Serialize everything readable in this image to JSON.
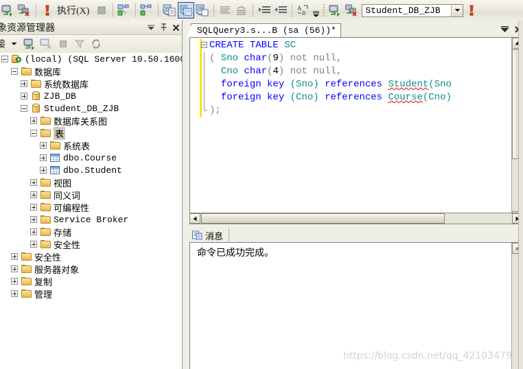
{
  "toolbar": {
    "buttons": [
      {
        "name": "connect-object-explorer-icon",
        "tip": "连接"
      },
      {
        "name": "disconnect-object-explorer-icon",
        "tip": "断开连接"
      },
      {
        "name": "execute-exclamation-icon",
        "tip": "执行"
      }
    ],
    "execute_label": "执行(X)",
    "database_value": "Student_DB_ZJB",
    "overflow_label": "▼"
  },
  "object_explorer": {
    "title": "象资源管理器",
    "title_full": "对象资源管理器",
    "auto_hide_label": "⚏",
    "close_label": "✕",
    "toolbar": {
      "connect_label": "接",
      "connect_label_full": "连接",
      "dropdown_arrow": "▾"
    },
    "tree": [
      {
        "level": 0,
        "expander": "minus",
        "icon": "server-icon",
        "label": "(local) (SQL Server 10.50.1600",
        "mono": true,
        "selected": false
      },
      {
        "level": 1,
        "expander": "minus",
        "icon": "folder-icon",
        "label": "数据库",
        "mono": false,
        "selected": false
      },
      {
        "level": 2,
        "expander": "plus",
        "icon": "folder-icon",
        "label": "系统数据库",
        "mono": false,
        "selected": false
      },
      {
        "level": 2,
        "expander": "plus",
        "icon": "database-icon",
        "label": "ZJB_DB",
        "mono": true,
        "selected": false
      },
      {
        "level": 2,
        "expander": "minus",
        "icon": "database-icon",
        "label": "Student_DB_ZJB",
        "mono": true,
        "selected": false
      },
      {
        "level": 3,
        "expander": "plus",
        "icon": "folder-icon",
        "label": "数据库关系图",
        "mono": false,
        "selected": false
      },
      {
        "level": 3,
        "expander": "minus",
        "icon": "folder-icon",
        "label": "表",
        "mono": false,
        "selected": true
      },
      {
        "level": 4,
        "expander": "plus",
        "icon": "folder-icon",
        "label": "系统表",
        "mono": false,
        "selected": false
      },
      {
        "level": 4,
        "expander": "plus",
        "icon": "table-icon",
        "label": "dbo.Course",
        "mono": true,
        "selected": false
      },
      {
        "level": 4,
        "expander": "plus",
        "icon": "table-icon",
        "label": "dbo.Student",
        "mono": true,
        "selected": false
      },
      {
        "level": 3,
        "expander": "plus",
        "icon": "folder-icon",
        "label": "视图",
        "mono": false,
        "selected": false
      },
      {
        "level": 3,
        "expander": "plus",
        "icon": "folder-icon",
        "label": "同义词",
        "mono": false,
        "selected": false
      },
      {
        "level": 3,
        "expander": "plus",
        "icon": "folder-icon",
        "label": "可编程性",
        "mono": false,
        "selected": false
      },
      {
        "level": 3,
        "expander": "plus",
        "icon": "folder-icon",
        "label": "Service Broker",
        "mono": true,
        "selected": false
      },
      {
        "level": 3,
        "expander": "plus",
        "icon": "folder-icon",
        "label": "存储",
        "mono": false,
        "selected": false
      },
      {
        "level": 3,
        "expander": "plus",
        "icon": "folder-icon",
        "label": "安全性",
        "mono": false,
        "selected": false
      },
      {
        "level": 1,
        "expander": "plus",
        "icon": "folder-icon",
        "label": "安全性",
        "mono": false,
        "selected": false
      },
      {
        "level": 1,
        "expander": "plus",
        "icon": "folder-icon",
        "label": "服务器对象",
        "mono": false,
        "selected": false
      },
      {
        "level": 1,
        "expander": "plus",
        "icon": "folder-icon",
        "label": "复制",
        "mono": false,
        "selected": false
      },
      {
        "level": 1,
        "expander": "plus",
        "icon": "folder-icon",
        "label": "管理",
        "mono": false,
        "selected": false
      }
    ]
  },
  "editor": {
    "tab_label": "SQLQuery3.s...B (sa (56))*",
    "tab_menu_label": "⇟",
    "tab_close_label": "✕",
    "code_lines": [
      [
        {
          "t": "CREATE",
          "c": "kw"
        },
        {
          "t": " ",
          "c": "pl"
        },
        {
          "t": "TABLE",
          "c": "kw"
        },
        {
          "t": " ",
          "c": "pl"
        },
        {
          "t": "SC",
          "c": "ty"
        }
      ],
      [
        {
          "t": "( ",
          "c": "gy"
        },
        {
          "t": "Sno",
          "c": "ty"
        },
        {
          "t": " ",
          "c": "pl"
        },
        {
          "t": "char",
          "c": "kw"
        },
        {
          "t": "(",
          "c": "gy"
        },
        {
          "t": "9",
          "c": "pl"
        },
        {
          "t": ")",
          "c": "gy"
        },
        {
          "t": " ",
          "c": "pl"
        },
        {
          "t": "not null",
          "c": "gy"
        },
        {
          "t": ",",
          "c": "gy"
        }
      ],
      [
        {
          "t": "  ",
          "c": "pl"
        },
        {
          "t": "Cno",
          "c": "ty"
        },
        {
          "t": " ",
          "c": "pl"
        },
        {
          "t": "char",
          "c": "kw"
        },
        {
          "t": "(",
          "c": "gy"
        },
        {
          "t": "4",
          "c": "pl"
        },
        {
          "t": ")",
          "c": "gy"
        },
        {
          "t": " ",
          "c": "pl"
        },
        {
          "t": "not null",
          "c": "gy"
        },
        {
          "t": ",",
          "c": "gy"
        }
      ],
      [
        {
          "t": "  ",
          "c": "pl"
        },
        {
          "t": "foreign key",
          "c": "kw"
        },
        {
          "t": " ",
          "c": "pl"
        },
        {
          "t": "(Sno)",
          "c": "ty"
        },
        {
          "t": " ",
          "c": "pl"
        },
        {
          "t": "references",
          "c": "kw"
        },
        {
          "t": " ",
          "c": "pl"
        },
        {
          "t": "Student",
          "c": "ty sq"
        },
        {
          "t": "(Sno",
          "c": "ty"
        }
      ],
      [
        {
          "t": "  ",
          "c": "pl"
        },
        {
          "t": "foreign key",
          "c": "kw"
        },
        {
          "t": " ",
          "c": "pl"
        },
        {
          "t": "(Cno)",
          "c": "ty"
        },
        {
          "t": " ",
          "c": "pl"
        },
        {
          "t": "references",
          "c": "kw"
        },
        {
          "t": " ",
          "c": "pl"
        },
        {
          "t": "Course",
          "c": "ty sq"
        },
        {
          "t": "(Cno)",
          "c": "ty"
        }
      ],
      [
        {
          "t": ");",
          "c": "gy"
        }
      ]
    ],
    "code_plain": "CREATE TABLE SC\n ( Sno char(9) not null,\n   Cno char(4) not null,\n   foreign key (Sno) references Student(Sno\n   foreign key (Cno) references Course(Cno)\n );"
  },
  "results": {
    "tab_label": "消息",
    "tab_icon": "messages-icon",
    "message_text": "命令已成功完成。"
  },
  "watermark": {
    "text": "https://blog.csdn.net/qq_42103479"
  },
  "scrollbars": {
    "v_up_label": "▲",
    "v_down_label": "▼",
    "h_left_label": "◀",
    "h_right_label": "▶",
    "msg_up_label": "▲"
  },
  "colors": {
    "keyword": "#0000ff",
    "type": "#0f8a8a",
    "gray": "#808080",
    "selection": "#cdc9b4",
    "change_bar": "#ffe400",
    "squiggle": "#e00000",
    "chrome": "#f0efe6"
  }
}
